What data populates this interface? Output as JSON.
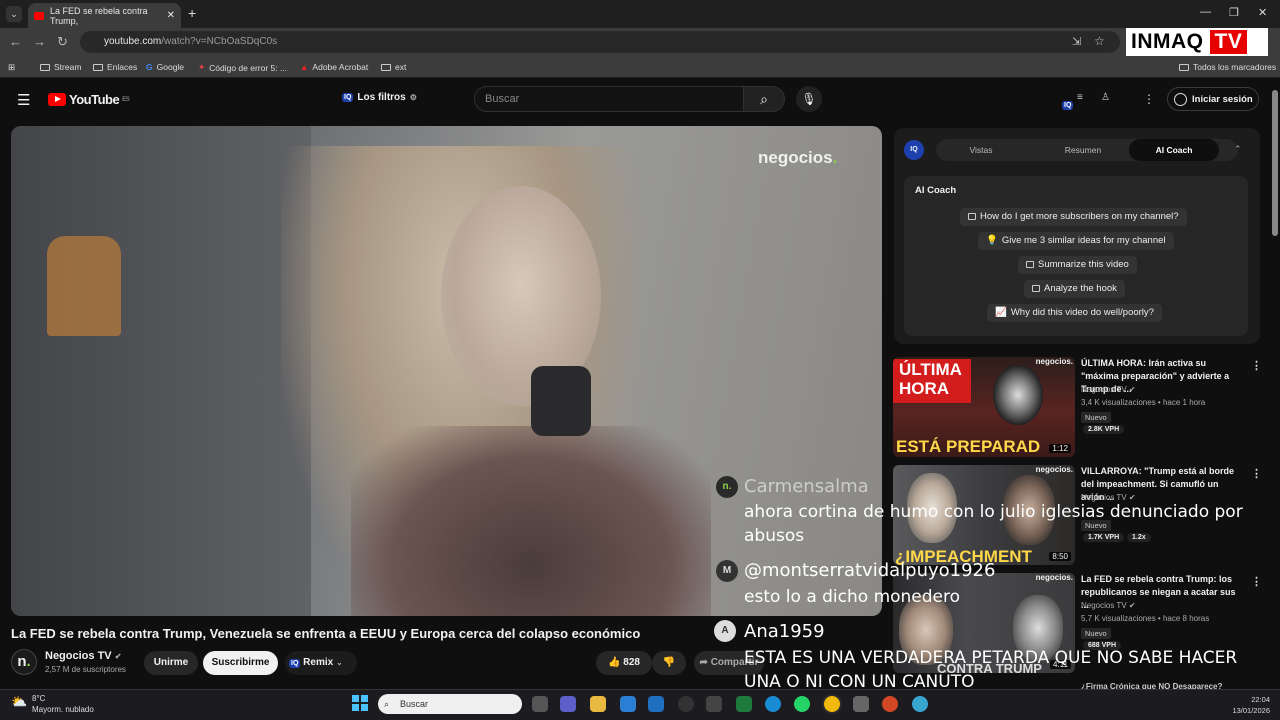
{
  "browser": {
    "tab_title": "La FED se rebela contra Trump,",
    "url_domain": "youtube.com",
    "url_path": "/watch?v=NCbOaSDqC0s",
    "bookmarks": [
      "Stream",
      "Enlaces",
      "Google",
      "Código de error 5: ...",
      "Adobe Acrobat",
      "ext"
    ],
    "all_bookmarks": "Todos los marcadores",
    "overlay_brand": "INMAQ",
    "overlay_brand_tv": "TV"
  },
  "youtube": {
    "logo": "YouTube",
    "logo_region": "ES",
    "filters_label": "Los filtros",
    "search_placeholder": "Buscar",
    "signin": "Iniciar sesión"
  },
  "video": {
    "watermark": "negocios",
    "title": "La FED se rebela contra Trump, Venezuela se enfrenta a EEUU y Europa cerca del colapso económico",
    "channel": "Negocios TV",
    "subscribers": "2,57 M de suscriptores",
    "join": "Unirme",
    "subscribe": "Suscribirme",
    "remix": "Remix",
    "likes": "828",
    "share": "Compartir"
  },
  "panel": {
    "tabs": [
      "Vistas",
      "Resumen",
      "AI Coach"
    ],
    "active_tab": "AI Coach",
    "heading": "AI Coach",
    "questions": [
      "How do I get more subscribers on my channel?",
      "Give me 3 similar ideas for my channel",
      "Summarize this video",
      "Analyze the hook",
      "Why did this video do well/poorly?"
    ]
  },
  "recommendations": [
    {
      "title": "ÚLTIMA HORA: Irán activa su \"máxima preparación\" y advierte a Trump de ...",
      "channel": "Negocios TV",
      "meta": "3,4 K visualizaciones • hace 1 hora",
      "badge": "Nuevo",
      "vph": "2.8K VPH",
      "thumb_top": "ÚLTIMA",
      "thumb_top2": "HORA",
      "thumb_bottom": "ESTÁ PREPARAD",
      "thumb_brand": "negocios.",
      "duration": "1:12"
    },
    {
      "title": "VILLARROYA: \"Trump está al borde del impeachment. Si camufló un avión ...",
      "channel": "Negocios TV",
      "meta": "",
      "badge": "Nuevo",
      "vph": "1.7K VPH",
      "multiplier": "1.2x",
      "thumb_bottom": "¿IMPEACHMENT",
      "thumb_brand": "negocios.",
      "duration": "8:50"
    },
    {
      "title": "La FED se rebela contra Trump: los republicanos se niegan a acatar sus ...",
      "channel": "Negocios TV",
      "meta": "5,7 K visualizaciones • hace 8 horas",
      "badge": "Nuevo",
      "vph": "688 VPH",
      "thumb_bottom": "CONTRA TRUMP",
      "thumb_brand": "negocios.",
      "duration": "4:11"
    }
  ],
  "next_title_fragment": "¿Firma Crónica que NO Desaparece?",
  "comments": [
    {
      "author": "Carmensalma",
      "text": "ahora cortina de humo con lo julio iglesias denunciado por abusos",
      "avatar": "n."
    },
    {
      "author": "@montserratvidalpuyo1926",
      "text": "esto lo a dicho monedero",
      "avatar": "M"
    },
    {
      "author": "Ana1959",
      "text": "ESTA ES UNA VERDADERA PETARDA QUE NO SABE HACER UNA O NI CON UN CANUTO",
      "avatar": "A"
    }
  ],
  "taskbar": {
    "temp": "8°C",
    "weather": "Mayorm. nublado",
    "search": "Buscar",
    "time": "22:04",
    "date": "13/01/2026"
  }
}
